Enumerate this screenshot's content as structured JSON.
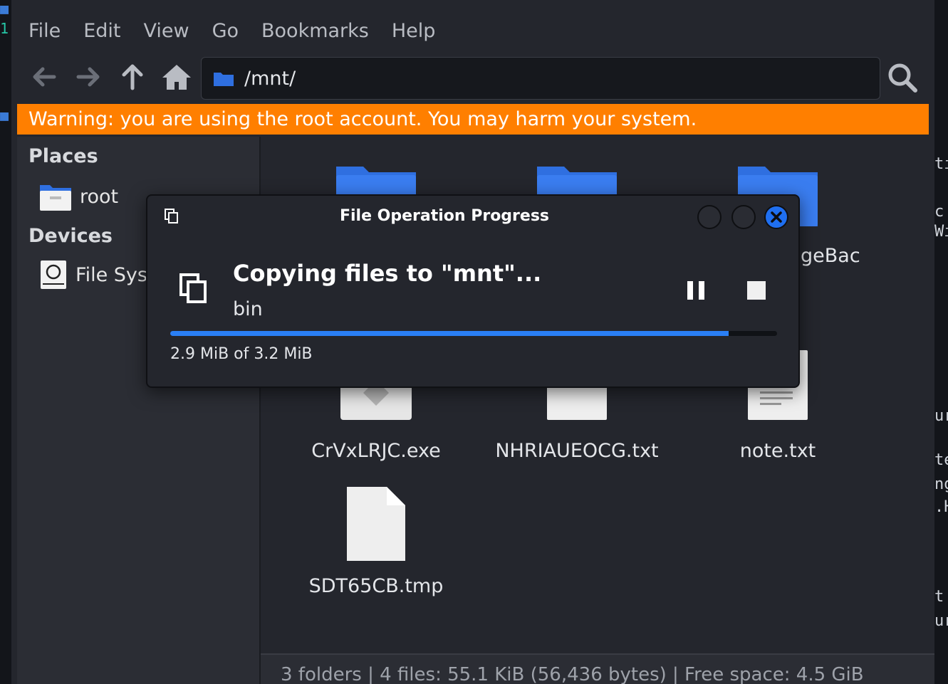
{
  "menubar": {
    "items": [
      "File",
      "Edit",
      "View",
      "Go",
      "Bookmarks",
      "Help"
    ]
  },
  "toolbar": {
    "path": "/mnt/"
  },
  "warning": {
    "text": "Warning: you are using the root account. You may harm your system."
  },
  "sidebar": {
    "places_heading": "Places",
    "places": [
      {
        "label": "root",
        "icon": "folder-home-icon"
      }
    ],
    "devices_heading": "Devices",
    "devices": [
      {
        "label": "File Sys",
        "icon": "drive-icon"
      }
    ]
  },
  "files": {
    "folders": [
      "",
      "",
      "geBac"
    ],
    "items": [
      {
        "name": "CrVxLRJC.exe",
        "icon": "executable-icon"
      },
      {
        "name": "NHRIAUEOCG.txt",
        "icon": "text-file-icon"
      },
      {
        "name": "note.txt",
        "icon": "text-file-icon"
      },
      {
        "name": "SDT65CB.tmp",
        "icon": "blank-file-icon"
      }
    ]
  },
  "statusbar": {
    "text": "3 folders  |  4 files: 55.1 KiB (56,436 bytes)  |  Free space: 4.5 GiB"
  },
  "dialog": {
    "title": "File Operation Progress",
    "heading": "Copying files to \"mnt\"...",
    "current_file": "bin",
    "progress_fraction": 0.92,
    "size_text": "2.9 MiB of 3.2 MiB"
  },
  "colors": {
    "warning_bg": "#ff7f00",
    "accent": "#2a7ff5",
    "folder": "#2f6fe0"
  },
  "background": {
    "right_edge_glyphs": [
      "ti",
      "c",
      "Wi",
      "ur",
      "te",
      "ng",
      ".H",
      "t",
      "ur"
    ]
  }
}
